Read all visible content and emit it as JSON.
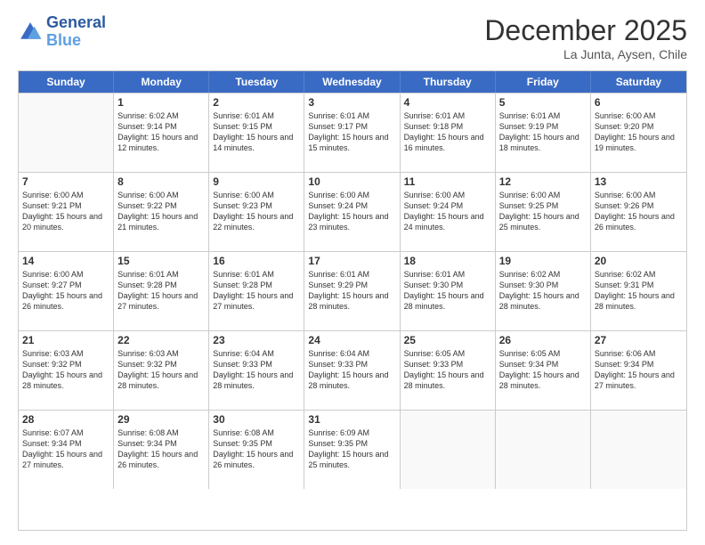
{
  "header": {
    "logo_general": "General",
    "logo_blue": "Blue",
    "month_title": "December 2025",
    "location": "La Junta, Aysen, Chile"
  },
  "weekdays": [
    "Sunday",
    "Monday",
    "Tuesday",
    "Wednesday",
    "Thursday",
    "Friday",
    "Saturday"
  ],
  "weeks": [
    [
      {
        "day": "",
        "sunrise": "",
        "sunset": "",
        "daylight": ""
      },
      {
        "day": "1",
        "sunrise": "Sunrise: 6:02 AM",
        "sunset": "Sunset: 9:14 PM",
        "daylight": "Daylight: 15 hours and 12 minutes."
      },
      {
        "day": "2",
        "sunrise": "Sunrise: 6:01 AM",
        "sunset": "Sunset: 9:15 PM",
        "daylight": "Daylight: 15 hours and 14 minutes."
      },
      {
        "day": "3",
        "sunrise": "Sunrise: 6:01 AM",
        "sunset": "Sunset: 9:17 PM",
        "daylight": "Daylight: 15 hours and 15 minutes."
      },
      {
        "day": "4",
        "sunrise": "Sunrise: 6:01 AM",
        "sunset": "Sunset: 9:18 PM",
        "daylight": "Daylight: 15 hours and 16 minutes."
      },
      {
        "day": "5",
        "sunrise": "Sunrise: 6:01 AM",
        "sunset": "Sunset: 9:19 PM",
        "daylight": "Daylight: 15 hours and 18 minutes."
      },
      {
        "day": "6",
        "sunrise": "Sunrise: 6:00 AM",
        "sunset": "Sunset: 9:20 PM",
        "daylight": "Daylight: 15 hours and 19 minutes."
      }
    ],
    [
      {
        "day": "7",
        "sunrise": "Sunrise: 6:00 AM",
        "sunset": "Sunset: 9:21 PM",
        "daylight": "Daylight: 15 hours and 20 minutes."
      },
      {
        "day": "8",
        "sunrise": "Sunrise: 6:00 AM",
        "sunset": "Sunset: 9:22 PM",
        "daylight": "Daylight: 15 hours and 21 minutes."
      },
      {
        "day": "9",
        "sunrise": "Sunrise: 6:00 AM",
        "sunset": "Sunset: 9:23 PM",
        "daylight": "Daylight: 15 hours and 22 minutes."
      },
      {
        "day": "10",
        "sunrise": "Sunrise: 6:00 AM",
        "sunset": "Sunset: 9:24 PM",
        "daylight": "Daylight: 15 hours and 23 minutes."
      },
      {
        "day": "11",
        "sunrise": "Sunrise: 6:00 AM",
        "sunset": "Sunset: 9:24 PM",
        "daylight": "Daylight: 15 hours and 24 minutes."
      },
      {
        "day": "12",
        "sunrise": "Sunrise: 6:00 AM",
        "sunset": "Sunset: 9:25 PM",
        "daylight": "Daylight: 15 hours and 25 minutes."
      },
      {
        "day": "13",
        "sunrise": "Sunrise: 6:00 AM",
        "sunset": "Sunset: 9:26 PM",
        "daylight": "Daylight: 15 hours and 26 minutes."
      }
    ],
    [
      {
        "day": "14",
        "sunrise": "Sunrise: 6:00 AM",
        "sunset": "Sunset: 9:27 PM",
        "daylight": "Daylight: 15 hours and 26 minutes."
      },
      {
        "day": "15",
        "sunrise": "Sunrise: 6:01 AM",
        "sunset": "Sunset: 9:28 PM",
        "daylight": "Daylight: 15 hours and 27 minutes."
      },
      {
        "day": "16",
        "sunrise": "Sunrise: 6:01 AM",
        "sunset": "Sunset: 9:28 PM",
        "daylight": "Daylight: 15 hours and 27 minutes."
      },
      {
        "day": "17",
        "sunrise": "Sunrise: 6:01 AM",
        "sunset": "Sunset: 9:29 PM",
        "daylight": "Daylight: 15 hours and 28 minutes."
      },
      {
        "day": "18",
        "sunrise": "Sunrise: 6:01 AM",
        "sunset": "Sunset: 9:30 PM",
        "daylight": "Daylight: 15 hours and 28 minutes."
      },
      {
        "day": "19",
        "sunrise": "Sunrise: 6:02 AM",
        "sunset": "Sunset: 9:30 PM",
        "daylight": "Daylight: 15 hours and 28 minutes."
      },
      {
        "day": "20",
        "sunrise": "Sunrise: 6:02 AM",
        "sunset": "Sunset: 9:31 PM",
        "daylight": "Daylight: 15 hours and 28 minutes."
      }
    ],
    [
      {
        "day": "21",
        "sunrise": "Sunrise: 6:03 AM",
        "sunset": "Sunset: 9:32 PM",
        "daylight": "Daylight: 15 hours and 28 minutes."
      },
      {
        "day": "22",
        "sunrise": "Sunrise: 6:03 AM",
        "sunset": "Sunset: 9:32 PM",
        "daylight": "Daylight: 15 hours and 28 minutes."
      },
      {
        "day": "23",
        "sunrise": "Sunrise: 6:04 AM",
        "sunset": "Sunset: 9:33 PM",
        "daylight": "Daylight: 15 hours and 28 minutes."
      },
      {
        "day": "24",
        "sunrise": "Sunrise: 6:04 AM",
        "sunset": "Sunset: 9:33 PM",
        "daylight": "Daylight: 15 hours and 28 minutes."
      },
      {
        "day": "25",
        "sunrise": "Sunrise: 6:05 AM",
        "sunset": "Sunset: 9:33 PM",
        "daylight": "Daylight: 15 hours and 28 minutes."
      },
      {
        "day": "26",
        "sunrise": "Sunrise: 6:05 AM",
        "sunset": "Sunset: 9:34 PM",
        "daylight": "Daylight: 15 hours and 28 minutes."
      },
      {
        "day": "27",
        "sunrise": "Sunrise: 6:06 AM",
        "sunset": "Sunset: 9:34 PM",
        "daylight": "Daylight: 15 hours and 27 minutes."
      }
    ],
    [
      {
        "day": "28",
        "sunrise": "Sunrise: 6:07 AM",
        "sunset": "Sunset: 9:34 PM",
        "daylight": "Daylight: 15 hours and 27 minutes."
      },
      {
        "day": "29",
        "sunrise": "Sunrise: 6:08 AM",
        "sunset": "Sunset: 9:34 PM",
        "daylight": "Daylight: 15 hours and 26 minutes."
      },
      {
        "day": "30",
        "sunrise": "Sunrise: 6:08 AM",
        "sunset": "Sunset: 9:35 PM",
        "daylight": "Daylight: 15 hours and 26 minutes."
      },
      {
        "day": "31",
        "sunrise": "Sunrise: 6:09 AM",
        "sunset": "Sunset: 9:35 PM",
        "daylight": "Daylight: 15 hours and 25 minutes."
      },
      {
        "day": "",
        "sunrise": "",
        "sunset": "",
        "daylight": ""
      },
      {
        "day": "",
        "sunrise": "",
        "sunset": "",
        "daylight": ""
      },
      {
        "day": "",
        "sunrise": "",
        "sunset": "",
        "daylight": ""
      }
    ]
  ]
}
